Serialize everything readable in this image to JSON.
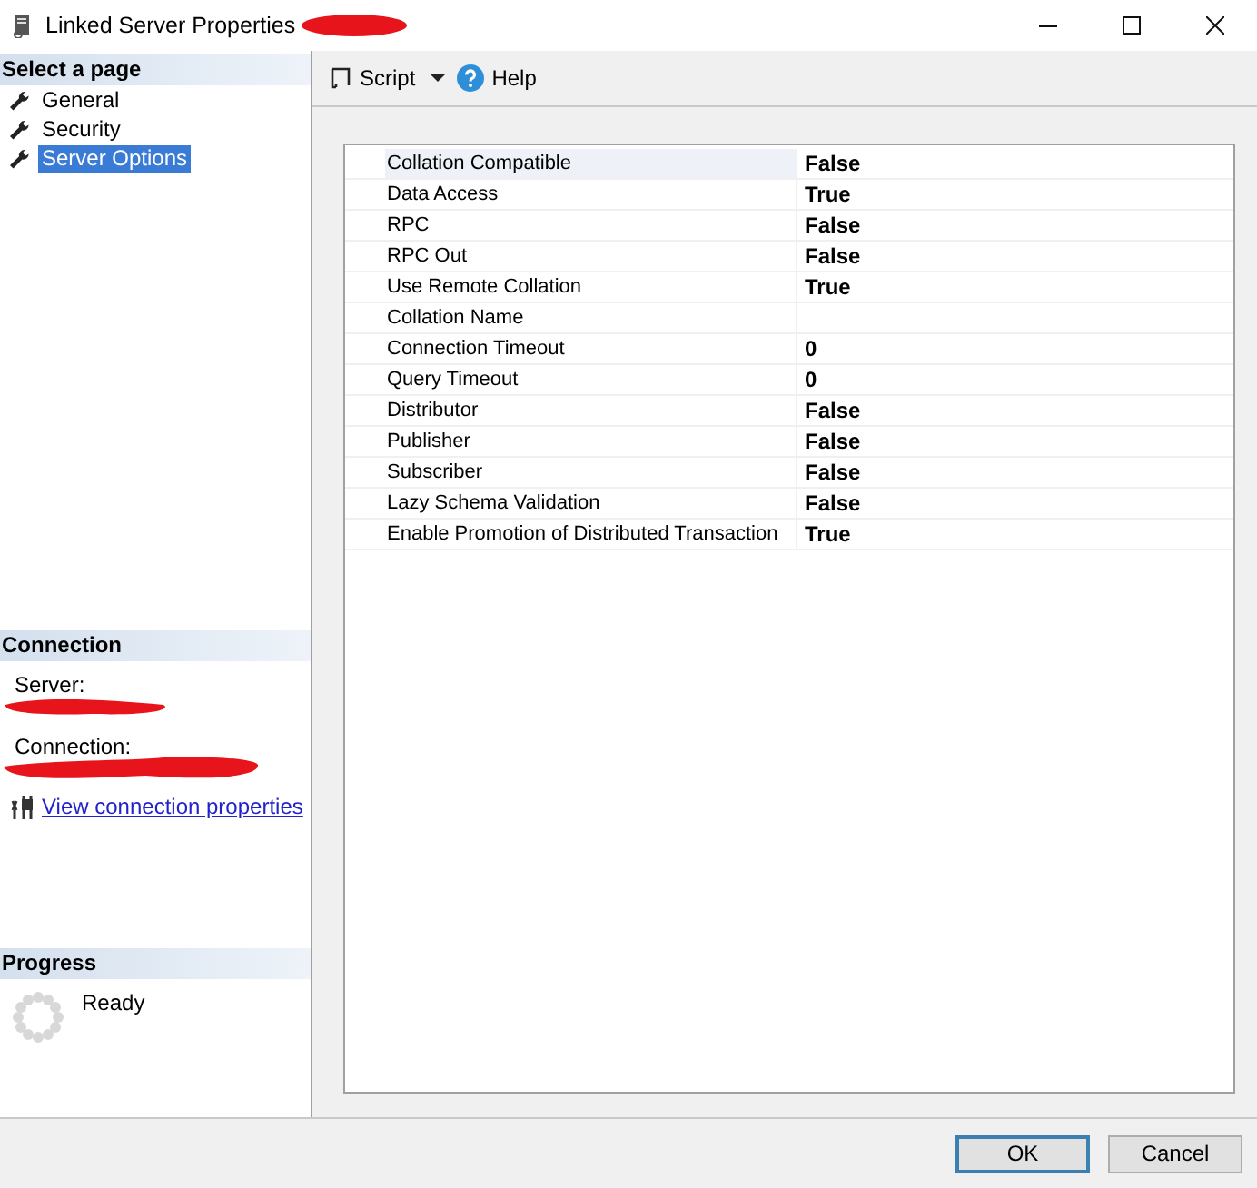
{
  "window": {
    "title": "Linked Server Properties"
  },
  "sidebar": {
    "title": "Select a page",
    "items": [
      {
        "label": "General",
        "selected": false
      },
      {
        "label": "Security",
        "selected": false
      },
      {
        "label": "Server Options",
        "selected": true
      }
    ]
  },
  "connection": {
    "title": "Connection",
    "server_label": "Server:",
    "connection_label": "Connection:",
    "link": "View connection properties"
  },
  "progress": {
    "title": "Progress",
    "status": "Ready"
  },
  "toolbar": {
    "script": "Script",
    "help": "Help"
  },
  "properties": [
    {
      "name": "Collation Compatible",
      "value": "False",
      "selected": true
    },
    {
      "name": "Data Access",
      "value": "True",
      "selected": false
    },
    {
      "name": "RPC",
      "value": "False",
      "selected": false
    },
    {
      "name": "RPC Out",
      "value": "False",
      "selected": false
    },
    {
      "name": "Use Remote Collation",
      "value": "True",
      "selected": false
    },
    {
      "name": "Collation Name",
      "selected": false
    },
    {
      "name": "Connection Timeout",
      "value": "0",
      "selected": false
    },
    {
      "name": "Query Timeout",
      "value": "0",
      "selected": false
    },
    {
      "name": "Distributor",
      "value": "False",
      "selected": false
    },
    {
      "name": "Publisher",
      "value": "False",
      "selected": false
    },
    {
      "name": "Subscriber",
      "value": "False",
      "selected": false
    },
    {
      "name": "Lazy Schema Validation",
      "value": "False",
      "selected": false
    },
    {
      "name": "Enable Promotion of Distributed Transaction",
      "value": "True",
      "selected": false
    }
  ],
  "buttons": [
    {
      "label": "OK",
      "default": true
    },
    {
      "label": "Cancel",
      "default": false
    }
  ]
}
